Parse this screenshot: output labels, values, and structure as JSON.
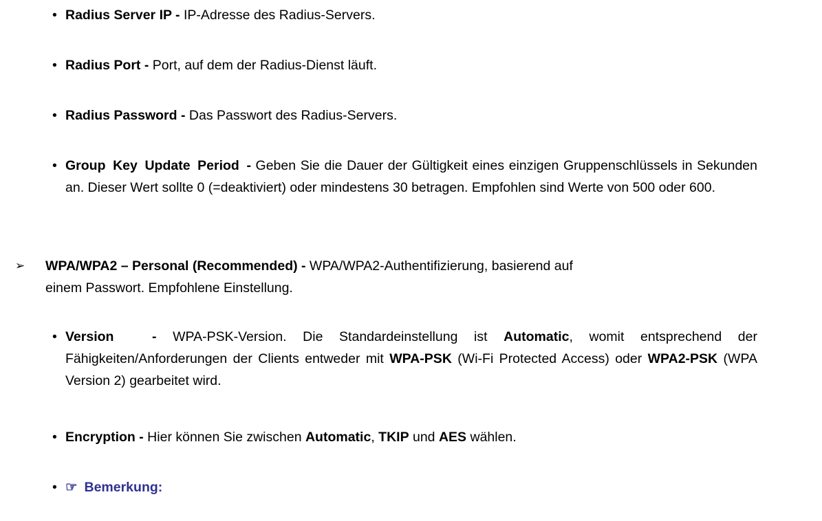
{
  "items": {
    "radius_ip": {
      "label": "Radius Server IP -",
      "text": " IP-Adresse des Radius-Servers."
    },
    "radius_port": {
      "label": "Radius Port -",
      "text": " Port, auf dem der Radius-Dienst läuft."
    },
    "radius_password": {
      "label": "Radius Password -",
      "text": " Das Passwort des Radius-Servers."
    },
    "group_key": {
      "label": "Group Key Update Period -",
      "text": " Geben Sie die Dauer der Gültigkeit eines einzigen Gruppenschlüssels in Sekunden an. Dieser Wert sollte 0 (=deaktiviert) oder mindestens 30 betragen. Empfohlen sind Werte von 500 oder 600."
    },
    "wpa_personal": {
      "label": "WPA/WPA2 – Personal (Recommended) -",
      "text_line1": " WPA/WPA2-Authentifizierung, basierend auf",
      "text_line2": "einem Passwort. Empfohlene Einstellung."
    },
    "version": {
      "label": "Version -",
      "t1": " WPA-PSK-Version. Die Standardeinstellung ist ",
      "b1": "Automatic",
      "t2": ", womit entsprechend der Fähigkeiten/Anforderungen der Clients entweder mit ",
      "b2": "WPA-PSK",
      "t3": " (Wi-Fi Protected Access) oder ",
      "b3": "WPA2-PSK",
      "t4": " (WPA Version 2) gearbeitet wird."
    },
    "encryption": {
      "label": "Encryption -",
      "t1": " Hier können Sie zwischen ",
      "b1": "Automatic",
      "t2": ", ",
      "b2": "TKIP",
      "t3": " und ",
      "b3": "AES",
      "t4": " wählen."
    },
    "note": {
      "icon": "pointing-hand-icon",
      "label": "Bemerkung:"
    }
  },
  "colors": {
    "text": "#000000",
    "note": "#2e3192"
  }
}
